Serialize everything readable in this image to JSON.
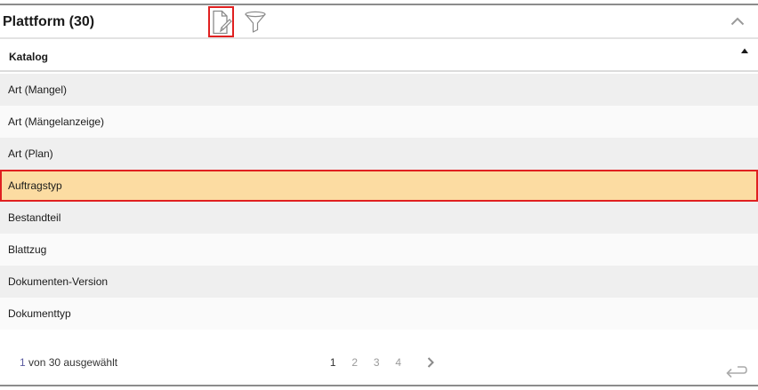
{
  "panel": {
    "title": "Plattform (30)",
    "toolbar": {
      "edit_icon": "document-edit-icon",
      "filter_icon": "filter-funnel-icon",
      "collapse_icon": "chevron-up-icon"
    }
  },
  "table": {
    "column_header": "Katalog",
    "sort": "ascending",
    "rows": [
      {
        "label": "Art (Mangel)",
        "selected": false
      },
      {
        "label": "Art (Mängelanzeige)",
        "selected": false
      },
      {
        "label": "Art (Plan)",
        "selected": false
      },
      {
        "label": "Auftragstyp",
        "selected": true
      },
      {
        "label": "Bestandteil",
        "selected": false
      },
      {
        "label": "Blattzug",
        "selected": false
      },
      {
        "label": "Dokumenten-Version",
        "selected": false
      },
      {
        "label": "Dokumenttyp",
        "selected": false
      }
    ]
  },
  "footer": {
    "selected_count": "1",
    "selected_suffix": " von 30 ausgewählt",
    "pages": [
      "1",
      "2",
      "3",
      "4"
    ],
    "current_page": "1",
    "next_icon": "chevron-right-icon",
    "back_icon": "return-arrow-icon"
  },
  "colors": {
    "selected_row": "#fcdca2",
    "highlight_border": "#e02020",
    "odd_row": "#efefef",
    "even_row": "#fafafa"
  }
}
